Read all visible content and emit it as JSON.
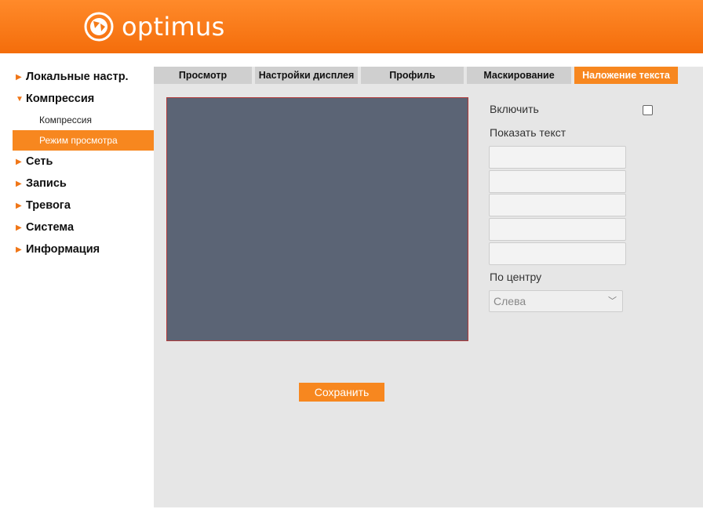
{
  "header": {
    "brand": "optimus",
    "logo_icon": "optimus-logo-icon",
    "colors": {
      "header": "#f47a16",
      "accent": "#f7871f"
    }
  },
  "sidebar": {
    "groups": [
      {
        "label": "Локальные настр.",
        "expanded": false
      },
      {
        "label": "Компрессия",
        "expanded": true,
        "items": [
          {
            "label": "Компрессия",
            "active": false
          },
          {
            "label": "Режим просмотра",
            "active": true
          }
        ]
      },
      {
        "label": "Сеть",
        "expanded": false
      },
      {
        "label": "Запись",
        "expanded": false
      },
      {
        "label": "Тревога",
        "expanded": false
      },
      {
        "label": "Система",
        "expanded": false
      },
      {
        "label": "Информация",
        "expanded": false
      }
    ]
  },
  "tabs": [
    {
      "label": "Просмотр",
      "active": false
    },
    {
      "label": "Настройки дисплея",
      "active": false
    },
    {
      "label": "Профиль",
      "active": false
    },
    {
      "label": "Маскирование",
      "active": false
    },
    {
      "label": "Наложение текста",
      "active": true
    }
  ],
  "form": {
    "enable_label": "Включить",
    "enable_checked": false,
    "show_text_label": "Показать текст",
    "text_fields": [
      "",
      "",
      "",
      "",
      ""
    ],
    "align_label": "По центру",
    "align_value": "Слева",
    "save_label": "Сохранить"
  }
}
